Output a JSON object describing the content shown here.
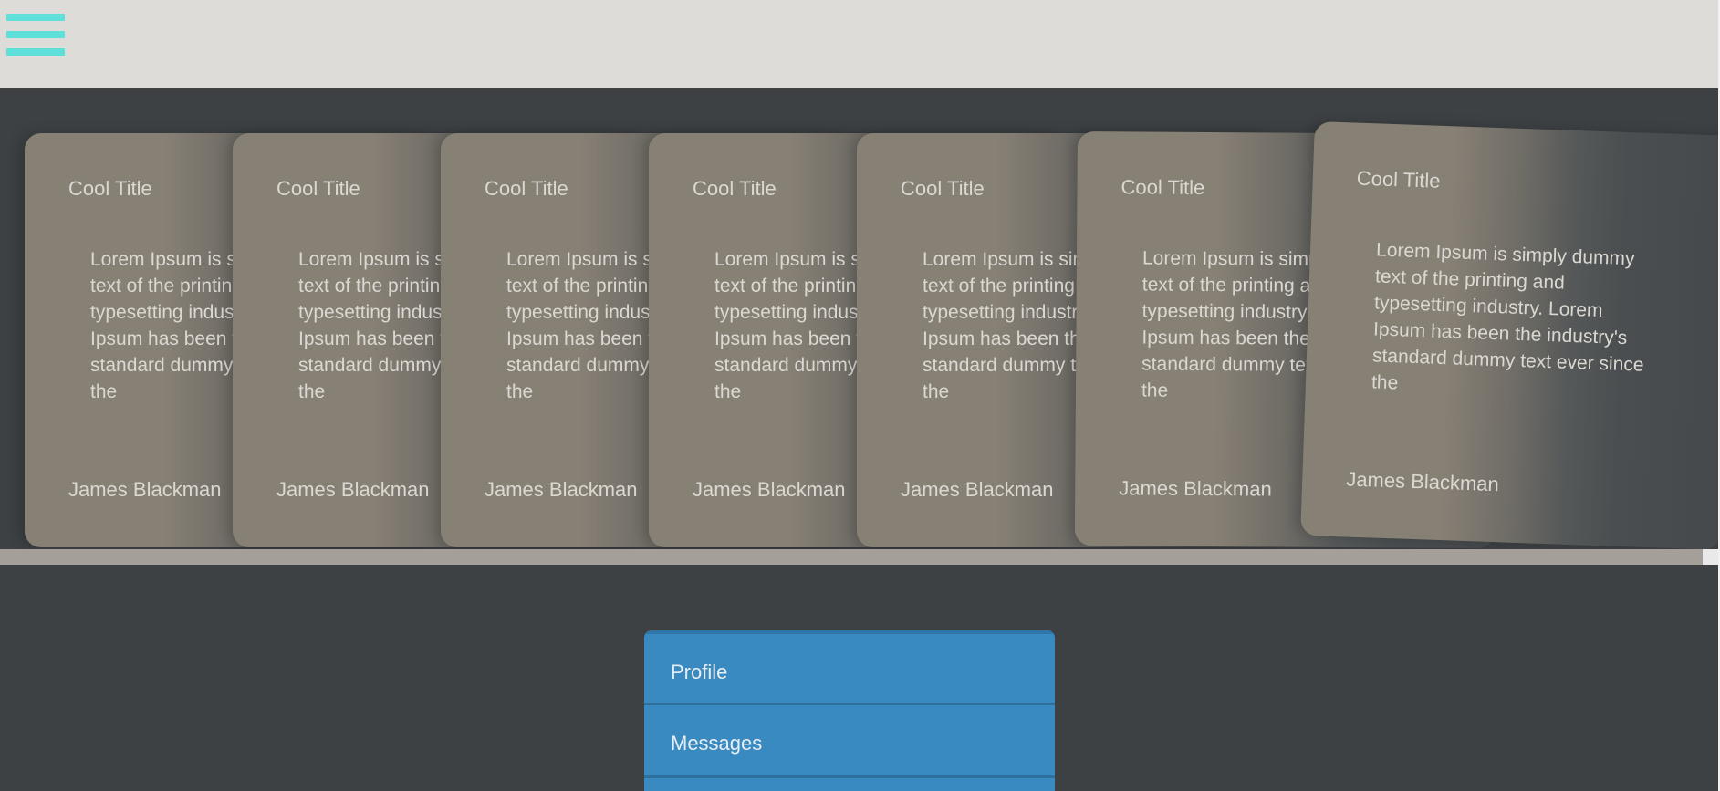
{
  "header": {
    "menu_icon": "hamburger-menu-icon",
    "menu_icon_color": "#5fdfd9"
  },
  "cards": [
    {
      "title": "Cool Title",
      "body": "Lorem Ipsum is simply dummy text of the printing and typesetting industry. Lorem Ipsum has been the industry's standard dummy text ever since the",
      "author": "James Blackman"
    },
    {
      "title": "Cool Title",
      "body": "Lorem Ipsum is simply dummy text of the printing and typesetting industry. Lorem Ipsum has been the industry's standard dummy text ever since the",
      "author": "James Blackman"
    },
    {
      "title": "Cool Title",
      "body": "Lorem Ipsum is simply dummy text of the printing and typesetting industry. Lorem Ipsum has been the industry's standard dummy text ever since the",
      "author": "James Blackman"
    },
    {
      "title": "Cool Title",
      "body": "Lorem Ipsum is simply dummy text of the printing and typesetting industry. Lorem Ipsum has been the industry's standard dummy text ever since the",
      "author": "James Blackman"
    },
    {
      "title": "Cool Title",
      "body": "Lorem Ipsum is simply dummy text of the printing and typesetting industry. Lorem Ipsum has been the industry's standard dummy text ever since the",
      "author": "James Blackman"
    },
    {
      "title": "Cool Title",
      "body": "Lorem Ipsum is simply dummy text of the printing and typesetting industry. Lorem Ipsum has been the industry's standard dummy text ever since the",
      "author": "James Blackman"
    },
    {
      "title": "Cool Title",
      "body": "Lorem Ipsum is simply dummy text of the printing and typesetting industry. Lorem Ipsum has been the industry's standard dummy text ever since the",
      "author": "James Blackman"
    }
  ],
  "menu": {
    "items": [
      {
        "label": "Profile"
      },
      {
        "label": "Messages"
      }
    ],
    "color": "#3a8ac2"
  }
}
